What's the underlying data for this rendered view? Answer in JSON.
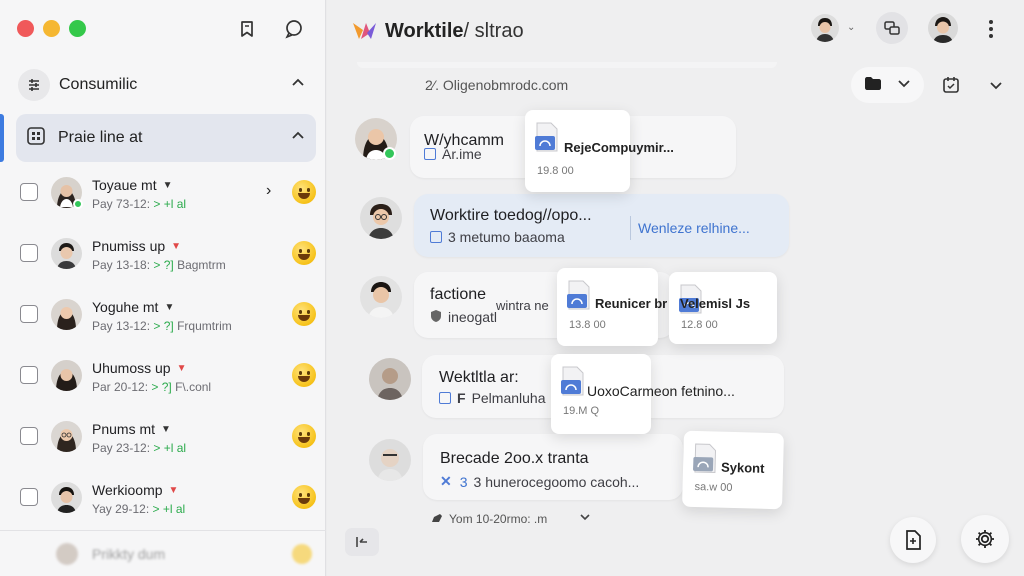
{
  "window": {
    "controls": [
      "close",
      "minimize",
      "maximize"
    ]
  },
  "sidebar": {
    "top_icons": [
      "bookmark-icon",
      "chat-bubble-icon"
    ],
    "section1": {
      "label": "Consumilic",
      "icon": "list-filter-icon"
    },
    "section2": {
      "label": "Praie line at",
      "icon": "grid-icon"
    },
    "dms": [
      {
        "name": "Toyaue mt",
        "sub_prefix": "Pay 73-12: ",
        "sub_green": "> +l al",
        "sub_rest": "",
        "online": true,
        "tri_color": "dark",
        "has_arrow": true
      },
      {
        "name": "Pnumiss up",
        "sub_prefix": "Pay 13-18: ",
        "sub_green": "> ?]",
        "sub_rest": " Bagmtrm",
        "online": false,
        "tri_color": "red",
        "has_arrow": false
      },
      {
        "name": "Yoguhe mt",
        "sub_prefix": "Pay 13-12: ",
        "sub_green": "> ?]",
        "sub_rest": " Frqumtrim",
        "online": false,
        "tri_color": "dark",
        "has_arrow": false
      },
      {
        "name": "Uhumoss up",
        "sub_prefix": "Par 20-12: ",
        "sub_green": "> ?]",
        "sub_rest": " F\\.conl",
        "online": false,
        "tri_color": "red",
        "has_arrow": false
      },
      {
        "name": "Pnums mt",
        "sub_prefix": "Pay 23-12: ",
        "sub_green": "> +l al",
        "sub_rest": "",
        "online": false,
        "tri_color": "dark",
        "has_arrow": false
      },
      {
        "name": "Werkioomp",
        "sub_prefix": "Yay 29-12: ",
        "sub_green": "> +l al",
        "sub_rest": "",
        "online": false,
        "tri_color": "red",
        "has_arrow": false
      }
    ],
    "blurred_item": "Prikkty dum"
  },
  "header": {
    "title_bold": "Worktile",
    "title_rest": "/ sltrao"
  },
  "main": {
    "email_line": "2⁄. Oligenobmrodc.com",
    "messages": [
      {
        "title": "W/yhcamm",
        "sub": "Ar.ime"
      },
      {
        "title": "Worktire toedog//opo...",
        "sub": "3 metumo baaoma",
        "link": "Wenleze relhine..."
      },
      {
        "title": "factione",
        "inline": "wintra ne",
        "sub": "ineogatl"
      },
      {
        "title": "Wektltla ar:",
        "sub": "Pelmanluha"
      },
      {
        "title": "Brecade 2oo.x tranta",
        "sub": "3 hunerocegoomo cacoh..."
      }
    ],
    "files": [
      {
        "name": "RejeCompuymir...",
        "size": "19.8 00"
      },
      {
        "name": "Reunicer br",
        "size": "13.8 00"
      },
      {
        "name": "Velemisl Js",
        "size": "12.8 00"
      },
      {
        "name": "UoxoCarmeon fetnino...",
        "size": "19.M Q"
      },
      {
        "name": "Sykont",
        "size": "sa.w 00"
      }
    ],
    "footer_text": "Yom 10-20rmo: .m"
  },
  "colors": {
    "accent": "#3d7be0",
    "online": "#33c65a",
    "link": "#3e73cf"
  }
}
